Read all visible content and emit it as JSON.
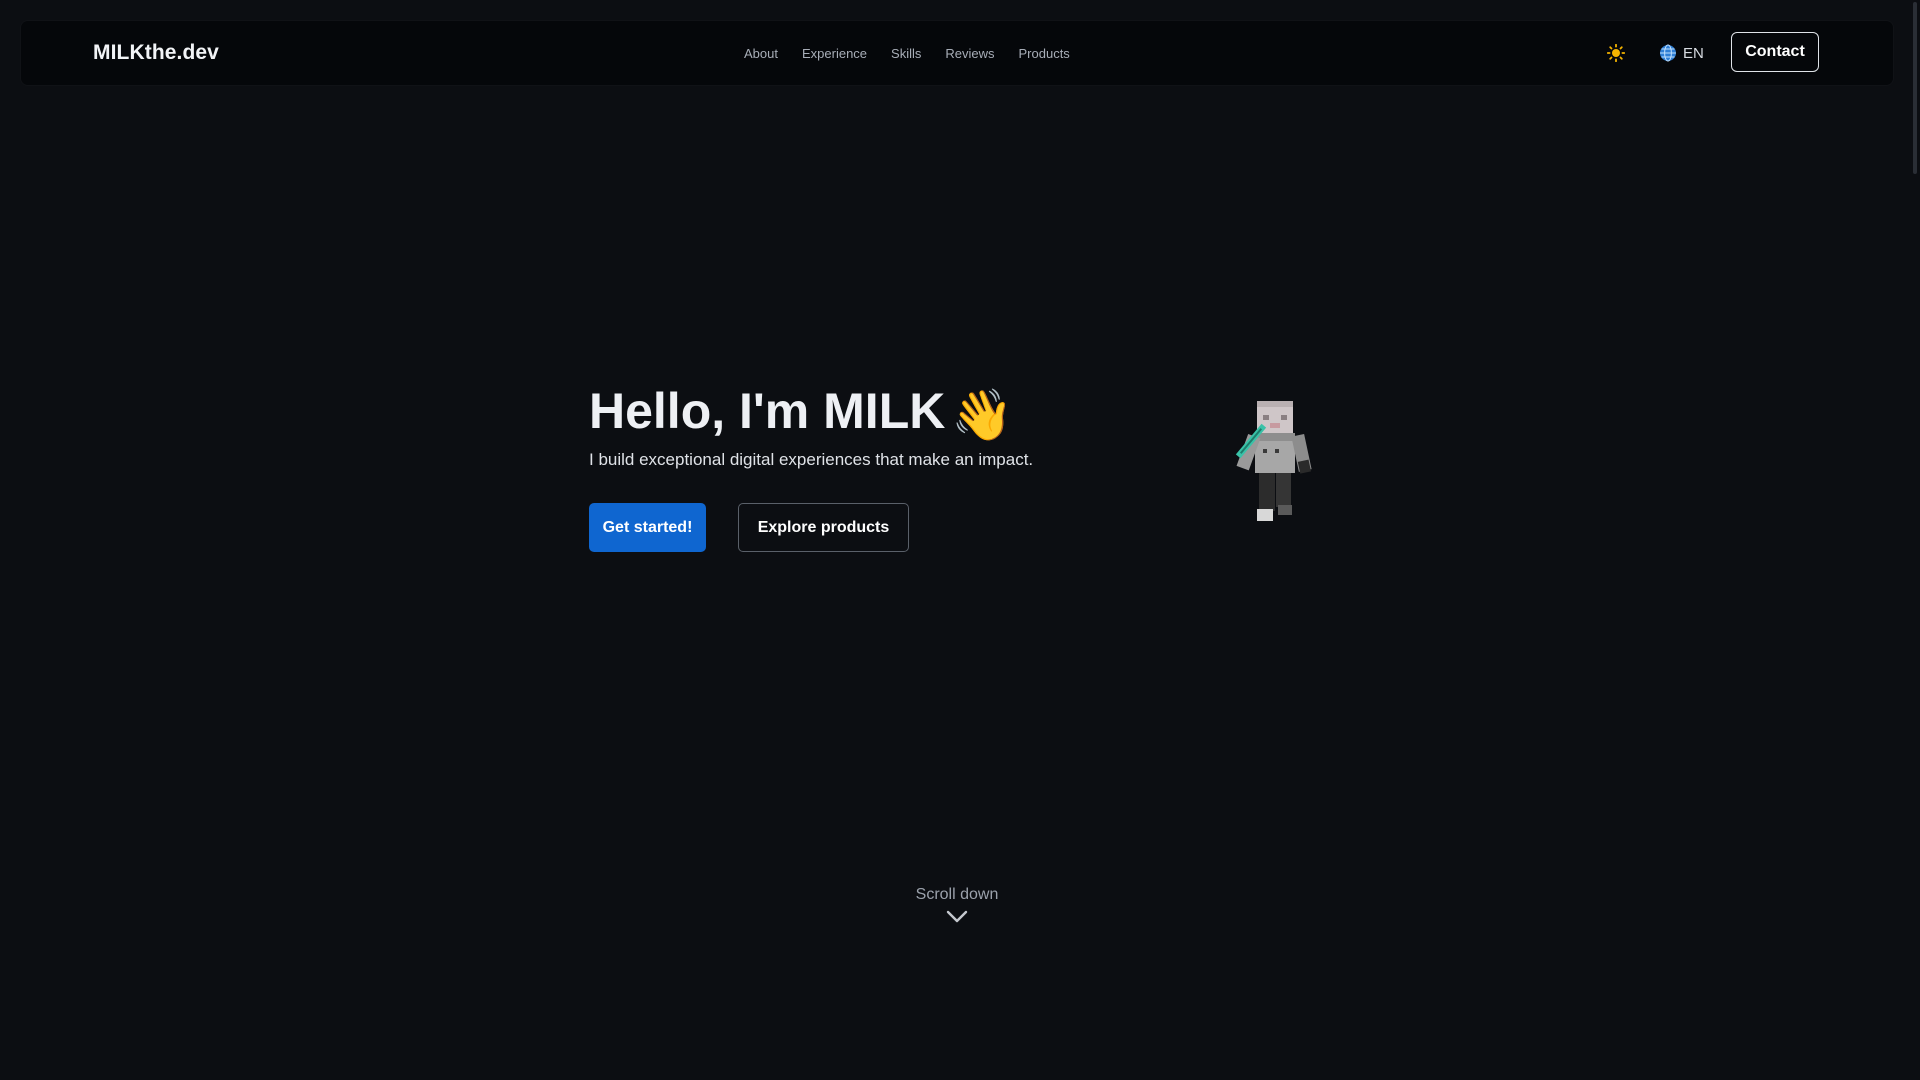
{
  "header": {
    "brand": "MILKthe.dev",
    "nav": [
      {
        "label": "About"
      },
      {
        "label": "Experience"
      },
      {
        "label": "Skills"
      },
      {
        "label": "Reviews"
      },
      {
        "label": "Products"
      }
    ],
    "theme_icon": "sun-icon",
    "language": {
      "icon": "globe-icon",
      "label": "EN"
    },
    "contact_label": "Contact"
  },
  "hero": {
    "title": "Hello, I'm MILK",
    "title_emoji": "👋",
    "subtitle": "I build exceptional digital experiences that make an impact.",
    "primary_label": "Get started!",
    "secondary_label": "Explore products",
    "avatar_icon": "minecraft-character-icon"
  },
  "scroll": {
    "label": "Scroll down",
    "icon": "chevron-down-icon"
  },
  "colors": {
    "background": "#0c0e12",
    "navbar": "#05070a",
    "accent": "#0f66d0",
    "sun": "#f5b400",
    "globe": "#3b8fe6"
  }
}
